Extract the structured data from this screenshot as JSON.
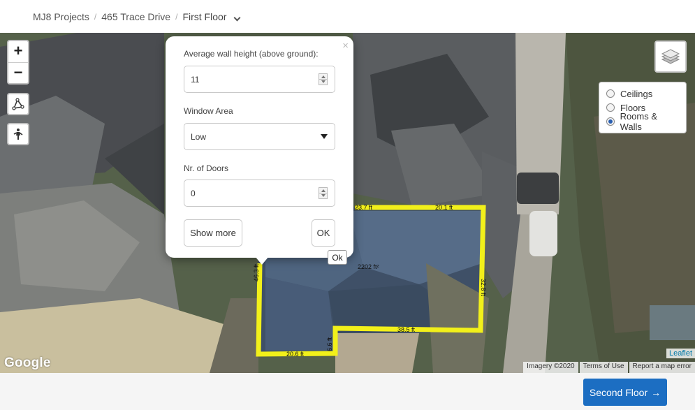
{
  "breadcrumb": {
    "items": [
      "MJ8 Projects",
      "465 Trace Drive"
    ],
    "current": "First Floor"
  },
  "map": {
    "zoom_in": "+",
    "zoom_out": "−",
    "layers": {
      "options": [
        {
          "label": "Ceilings",
          "selected": false
        },
        {
          "label": "Floors",
          "selected": false
        },
        {
          "label": "Rooms & Walls",
          "selected": true
        }
      ]
    },
    "measurements": {
      "segments": [
        "23.7 ft",
        "20.1 ft",
        "32.8 ft",
        "38.5 ft",
        "6.6 ft",
        "20.6 ft",
        "46.3 ft"
      ],
      "area": "2202 ft²"
    },
    "ok_tooltip": "Ok",
    "google_logo": "Google",
    "leaflet": "Leaflet",
    "attribution": [
      "Imagery ©2020",
      "Terms of Use",
      "Report a map error"
    ],
    "outline_color": "#f2f01a"
  },
  "popup": {
    "close": "×",
    "wall_height_label": "Average wall height (above ground):",
    "wall_height_value": "11",
    "window_area_label": "Window Area",
    "window_area_value": "Low",
    "doors_label": "Nr. of Doors",
    "doors_value": "0",
    "show_more": "Show more",
    "ok": "OK"
  },
  "footer": {
    "next_label": "Second Floor",
    "next_arrow": "→",
    "accent": "#1c6ec2"
  }
}
